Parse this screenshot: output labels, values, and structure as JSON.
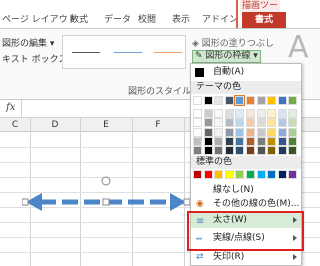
{
  "ribbon_tabs": {
    "page_layout": "ページ レイアウト",
    "formulas": "数式",
    "data": "データ",
    "review": "校閲",
    "view": "表示",
    "addins": "アドイン",
    "context_label": "描画ツール",
    "format": "書式"
  },
  "ribbon": {
    "edit_shape": "図形の編集",
    "text_box": "キスト ボックス",
    "shape_fill": "図形の塗りつぶし",
    "shape_outline": "図形の枠線",
    "group_label": "図形のスタイル",
    "big_letter": "A"
  },
  "formula_bar": {
    "fx": "fx"
  },
  "columns": [
    "C",
    "D",
    "E",
    "F"
  ],
  "menu": {
    "automatic": "自動(A)",
    "theme_colors_header": "テーマの色",
    "standard_colors_header": "標準の色",
    "no_outline": "線なし(N)",
    "more_colors": "その他の線の色(M)...",
    "weight": "太さ(W)",
    "dashes": "実線/点線(S)",
    "arrows": "矢印(R)"
  },
  "colors": {
    "accent": "#c0392b",
    "highlight": "#e02020",
    "arrow": "#4a86c8",
    "standard": [
      "#c00000",
      "#ff0000",
      "#ffc000",
      "#ffff00",
      "#92d050",
      "#00b050",
      "#00b0f0",
      "#0070c0",
      "#002060",
      "#7030a0"
    ],
    "theme_top": [
      "#ffffff",
      "#000000",
      "#e7e6e6",
      "#44546a",
      "#5b9bd5",
      "#ed7d31",
      "#a5a5a5",
      "#ffc000",
      "#4472c4",
      "#70ad47"
    ]
  }
}
